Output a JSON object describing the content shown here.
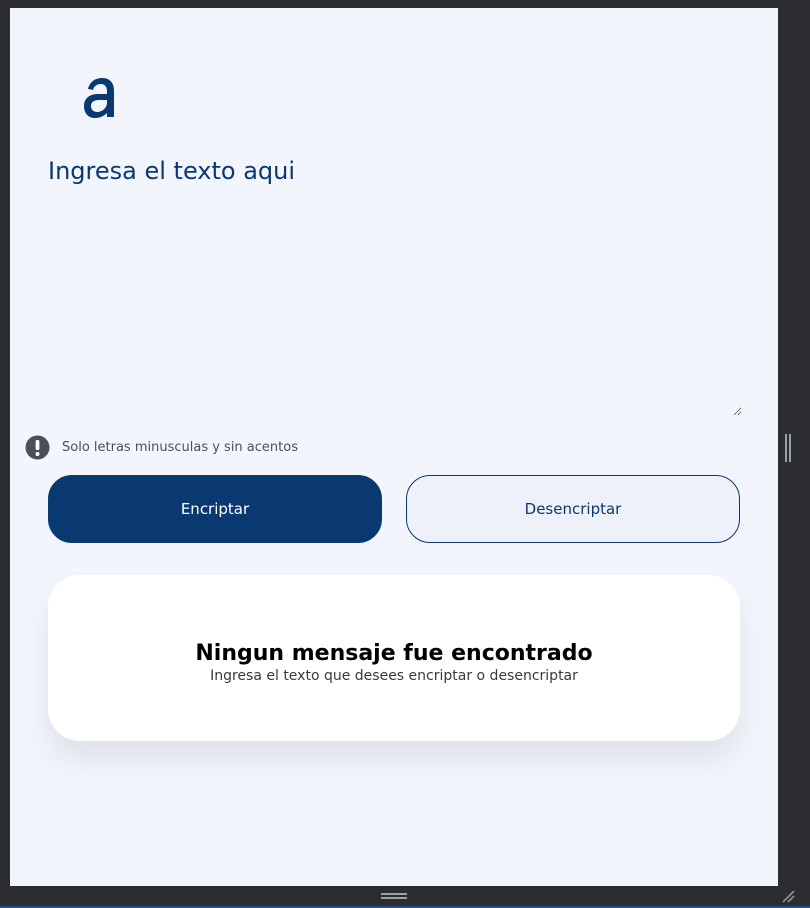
{
  "logo": {
    "icon": "alura-logo-icon",
    "color": "#0a3871"
  },
  "input": {
    "placeholder": "Ingresa el texto aqui",
    "value": ""
  },
  "hint": {
    "icon": "exclamation-icon",
    "text": "Solo letras minusculas y sin acentos"
  },
  "buttons": {
    "encrypt_label": "Encriptar",
    "decrypt_label": "Desencriptar"
  },
  "result": {
    "title": "Ningun mensaje fue encontrado",
    "subtitle": "Ingresa el texto que desees encriptar o desencriptar"
  },
  "colors": {
    "primary": "#0a3871",
    "background": "#f3f5fc",
    "card": "#ffffff",
    "frame": "#2b2d30"
  }
}
